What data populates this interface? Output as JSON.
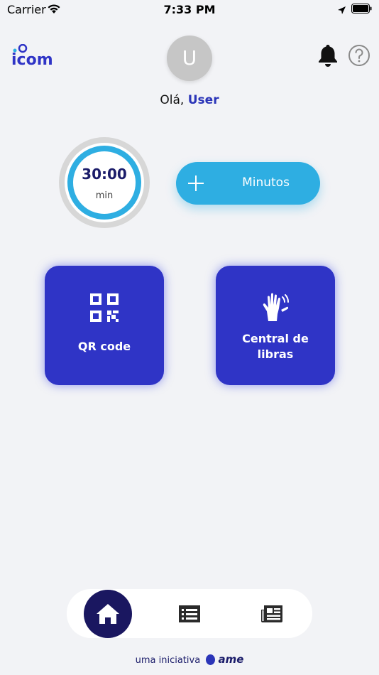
{
  "status_bar": {
    "carrier": "Carrier",
    "time": "7:33 PM"
  },
  "header": {
    "logo_text": "icom",
    "avatar_initial": "U",
    "greeting_prefix": "Olá,",
    "user_name": "User",
    "notification_icon": "bell-icon",
    "help_icon": "help-icon"
  },
  "timer": {
    "value": "30:00",
    "unit": "min"
  },
  "minutos_button": {
    "label": "Minutos",
    "icon": "plus-icon"
  },
  "tiles": [
    {
      "label": "QR code",
      "icon": "qr-code-icon"
    },
    {
      "label_line1": "Central de",
      "label_line2": "libras",
      "icon": "sign-language-icon"
    }
  ],
  "tabbar": {
    "items": [
      {
        "icon": "home-icon",
        "active": true
      },
      {
        "icon": "list-icon",
        "active": false
      },
      {
        "icon": "newspaper-icon",
        "active": false
      }
    ]
  },
  "footer": {
    "text": "uma iniciativa",
    "brand": "ame"
  },
  "colors": {
    "background": "#f2f3f6",
    "primary_blue": "#2f34c6",
    "accent_cyan": "#2eaee2",
    "navy": "#1a1760",
    "user_name": "#2b35b8"
  }
}
